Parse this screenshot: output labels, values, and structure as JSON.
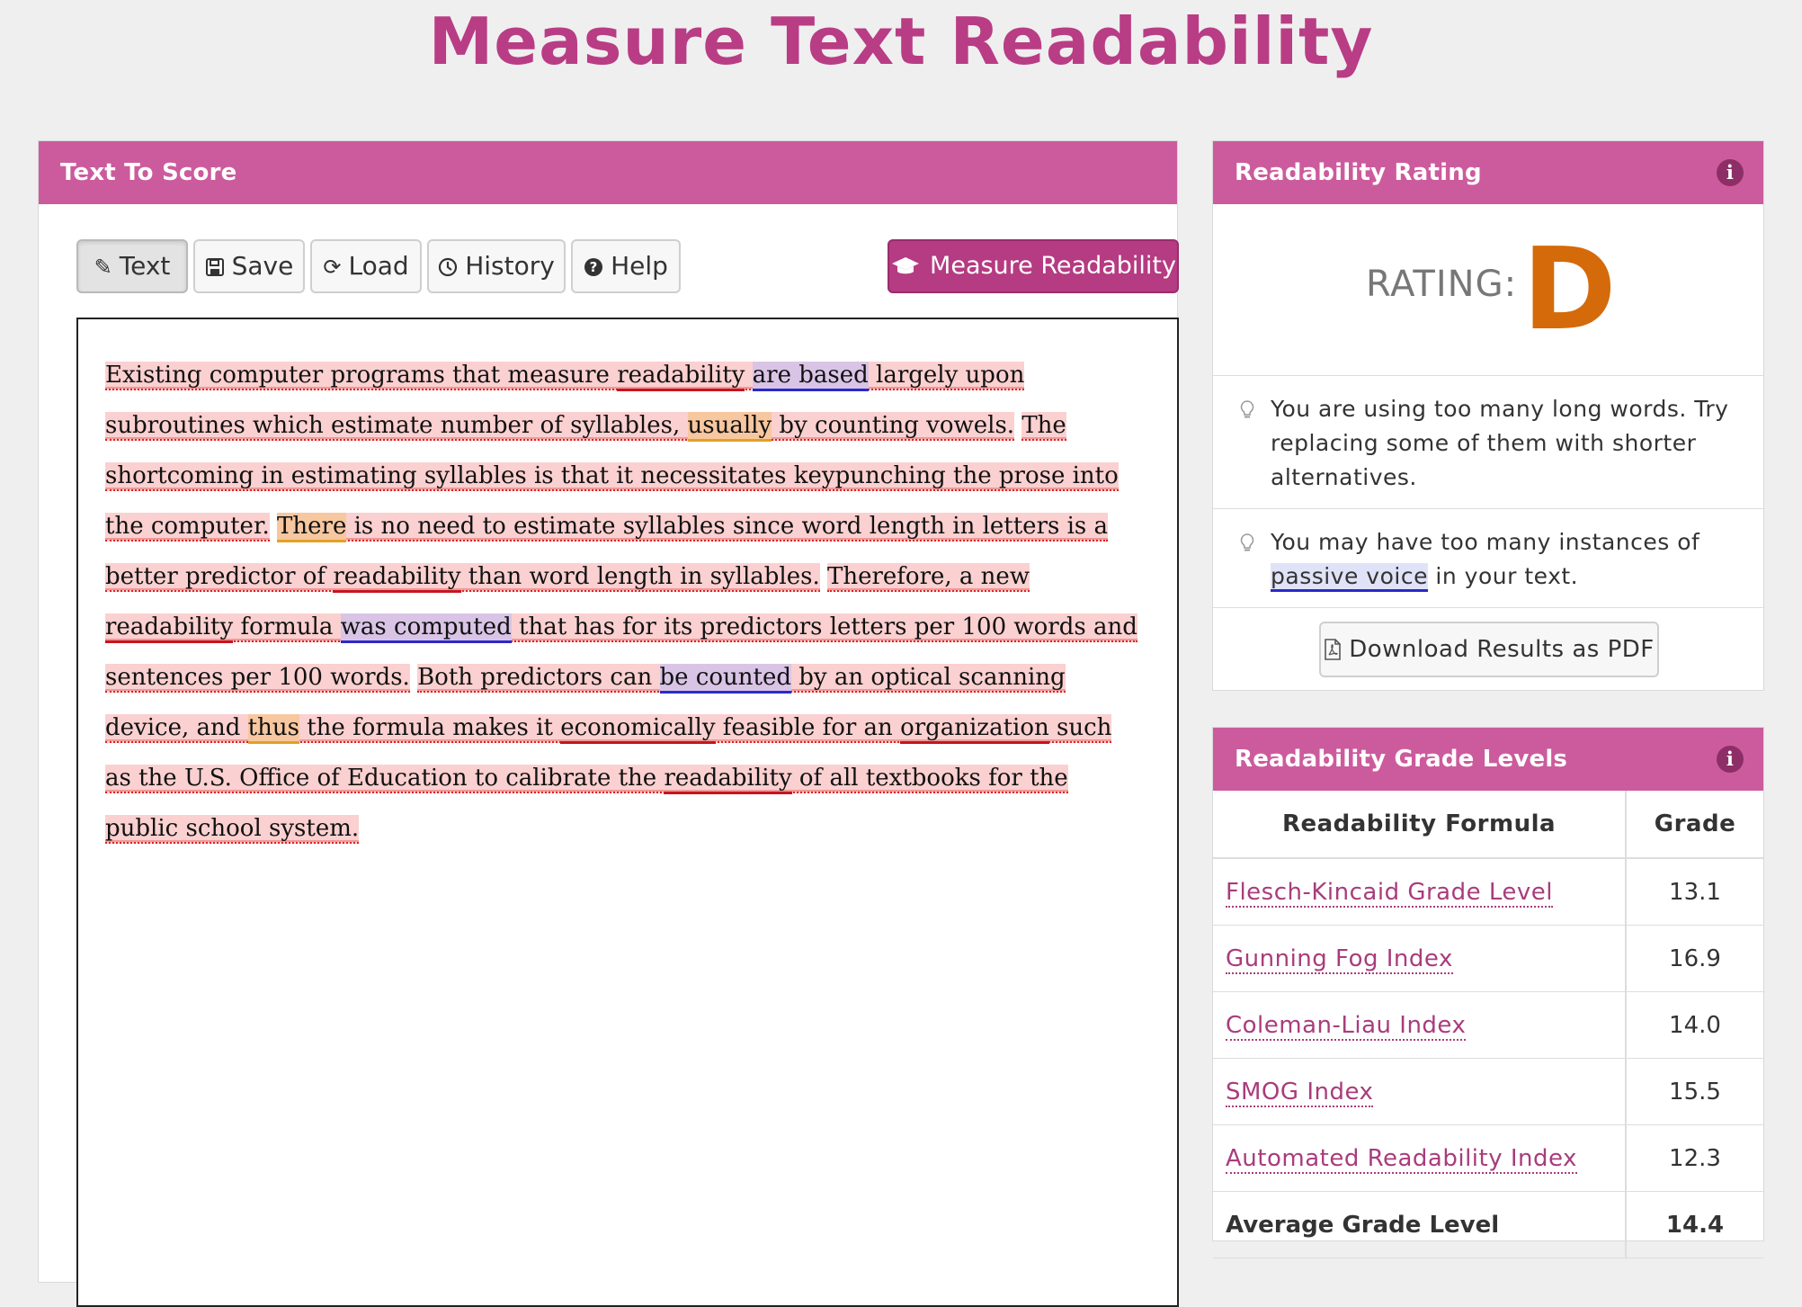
{
  "page_title": "Measure Text Readability",
  "text_panel": {
    "header": "Text To Score",
    "toolbar": {
      "text_label": "Text",
      "save_label": "Save",
      "load_label": "Load",
      "history_label": "History",
      "help_label": "Help",
      "measure_label": "Measure Readability"
    },
    "sentences": [
      {
        "style": "red",
        "segments": [
          {
            "t": "Existing computer programs that measure "
          },
          {
            "t": "readability",
            "f": "long"
          },
          {
            "t": " "
          },
          {
            "t": "are based",
            "f": "passive"
          },
          {
            "t": " largely upon subroutines which estimate number of syllables, "
          },
          {
            "t": "usually",
            "f": "adverb"
          },
          {
            "t": " by counting vowels."
          }
        ]
      },
      {
        "style": "red",
        "segments": [
          {
            "t": "The shortcoming in estimating syllables is that it necessitates keypunching the prose into the computer."
          }
        ]
      },
      {
        "style": "red",
        "segments": [
          {
            "t": "There",
            "f": "adverb"
          },
          {
            "t": " is no need to estimate syllables since word length in letters is a better predictor of "
          },
          {
            "t": "readability",
            "f": "long"
          },
          {
            "t": " than word length in syllables."
          }
        ]
      },
      {
        "style": "red",
        "segments": [
          {
            "t": "Therefore, a new "
          },
          {
            "t": "readability",
            "f": "long"
          },
          {
            "t": " formula "
          },
          {
            "t": "was computed",
            "f": "passive"
          },
          {
            "t": " that has for its predictors letters per 100 words and sentences per 100 words."
          }
        ]
      },
      {
        "style": "red",
        "segments": [
          {
            "t": "Both predictors can "
          },
          {
            "t": "be counted",
            "f": "passive"
          },
          {
            "t": " by an optical scanning device, and "
          },
          {
            "t": "thus",
            "f": "adverb"
          },
          {
            "t": " the formula makes it "
          },
          {
            "t": "economically",
            "f": "long"
          },
          {
            "t": " feasible for an "
          },
          {
            "t": "organization",
            "f": "long"
          },
          {
            "t": " such as the U.S. Office of Education to calibrate the "
          },
          {
            "t": "readability",
            "f": "long"
          },
          {
            "t": " of all textbooks for the public school system."
          }
        ]
      }
    ]
  },
  "rating_panel": {
    "header": "Readability Rating",
    "rating_label": "RATING:",
    "rating_value": "D",
    "tip1": "You are using too many long words. Try replacing some of them with shorter alternatives.",
    "tip2_prefix": "You may have too many instances of ",
    "tip2_highlight": "passive voice",
    "tip2_suffix": " in your text.",
    "download_label": "Download Results as PDF"
  },
  "grades_panel": {
    "header": "Readability Grade Levels",
    "col_formula": "Readability Formula",
    "col_grade": "Grade",
    "rows": [
      {
        "formula": "Flesch-Kincaid Grade Level",
        "grade": "13.1"
      },
      {
        "formula": "Gunning Fog Index",
        "grade": "16.9"
      },
      {
        "formula": "Coleman-Liau Index",
        "grade": "14.0"
      },
      {
        "formula": "SMOG Index",
        "grade": "15.5"
      },
      {
        "formula": "Automated Readability Index",
        "grade": "12.3"
      }
    ],
    "average_label": "Average Grade Level",
    "average_value": "14.4"
  },
  "colors": {
    "brand": "#b83d85",
    "header_bg": "#cc5b9d",
    "rating_color": "#d46a09",
    "hard_sentence": "#fbd0d0",
    "medium_sentence": "#fcfbc8",
    "passive": "#2a2ac8",
    "long_word": "#c8141e",
    "adverb": "#e3a024"
  },
  "icons": {
    "text": "pencil-icon",
    "save": "floppy-disk-icon",
    "load": "refresh-icon",
    "history": "clock-icon",
    "help": "question-circle-icon",
    "measure": "graduation-cap-icon",
    "info": "info-icon",
    "tip": "lightbulb-icon",
    "download": "pdf-file-icon"
  }
}
